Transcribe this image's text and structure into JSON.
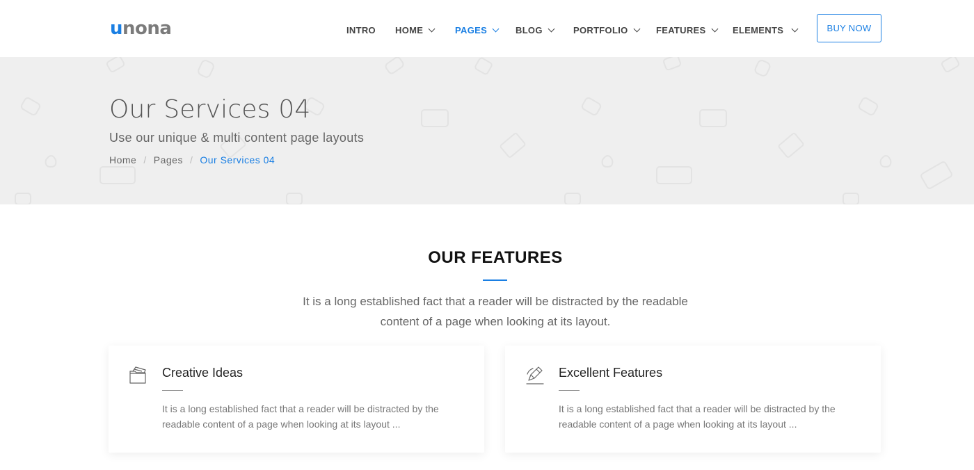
{
  "logo": {
    "first": "u",
    "rest": "nona"
  },
  "nav": {
    "items": [
      {
        "label": "INTRO",
        "dropdown": false,
        "active": false
      },
      {
        "label": "HOME",
        "dropdown": true,
        "active": false
      },
      {
        "label": "PAGES",
        "dropdown": true,
        "active": true
      },
      {
        "label": "BLOG",
        "dropdown": true,
        "active": false
      },
      {
        "label": "PORTFOLIO",
        "dropdown": true,
        "active": false
      },
      {
        "label": "FEATURES",
        "dropdown": true,
        "active": false
      },
      {
        "label": "ELEMENTS",
        "dropdown": true,
        "active": false
      }
    ],
    "buy_label": "BUY NOW"
  },
  "hero": {
    "title": "Our Services 04",
    "subtitle": "Use our unique & multi content page layouts",
    "breadcrumb": [
      "Home",
      "Pages",
      "Our Services 04"
    ],
    "separator": "/"
  },
  "features": {
    "title": "OUR FEATURES",
    "description_line1": "It is a long established fact that a reader will be distracted by the readable",
    "description_line2": "content of a page when looking at its layout.",
    "cards": [
      {
        "icon": "folder-icon",
        "title": "Creative Ideas",
        "text": "It is a long established fact that a reader will be distracted by the readable content of a page when looking at its layout ..."
      },
      {
        "icon": "pen-edit-icon",
        "title": "Excellent Features",
        "text": "It is a long established fact that a reader will be distracted by the readable content of a page when looking at its layout ..."
      }
    ]
  },
  "colors": {
    "accent": "#1a7fe3",
    "hero_bg": "#efefef",
    "text": "#333333"
  }
}
